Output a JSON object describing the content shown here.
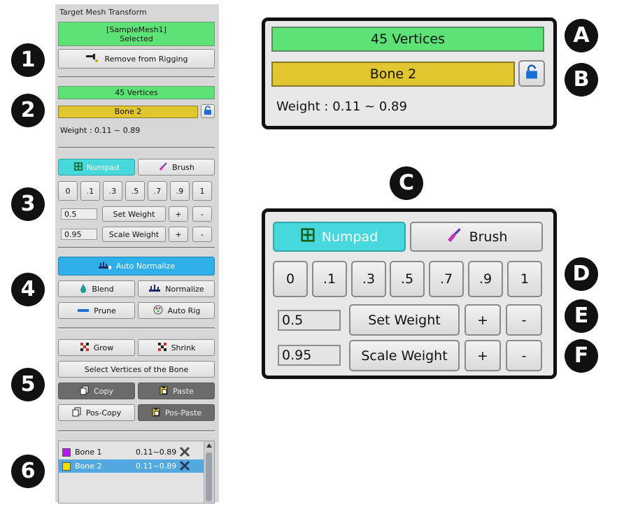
{
  "markers": [
    "1",
    "2",
    "3",
    "4",
    "5",
    "6",
    "A",
    "B",
    "C",
    "D",
    "E",
    "F"
  ],
  "panel": {
    "title": "Target Mesh Transform",
    "selected_mesh": "[SampleMesh1]",
    "selected_state": "Selected",
    "remove_rigging": "Remove from Rigging",
    "vertices": "45 Vertices",
    "bone": "Bone 2",
    "weight": "Weight : 0.11 ~ 0.89",
    "numpad": "Numpad",
    "brush": "Brush",
    "numkeys": [
      "0",
      ".1",
      ".3",
      ".5",
      ".7",
      ".9",
      "1"
    ],
    "set_value": "0.5",
    "set_weight": "Set Weight",
    "scale_value": "0.95",
    "scale_weight": "Scale Weight",
    "plus": "+",
    "minus": "-",
    "auto_normalize": "Auto Normalize",
    "blend": "Blend",
    "normalize": "Normalize",
    "prune": "Prune",
    "auto_rig": "Auto Rig",
    "grow": "Grow",
    "shrink": "Shrink",
    "select_vertices": "Select Vertices of the Bone",
    "copy": "Copy",
    "paste": "Paste",
    "pos_copy": "Pos-Copy",
    "pos_paste": "Pos-Paste",
    "bones": [
      {
        "name": "Bone 1",
        "range": "0.11~0.89",
        "color": "#b01ee6"
      },
      {
        "name": "Bone 2",
        "range": "0.11~0.89",
        "color": "#f2e000"
      }
    ]
  },
  "colors": {
    "green": "#5de276",
    "yellow": "#e2c62f",
    "cyan": "#46d8dc",
    "blue": "#2fb0e8",
    "selected_row": "#52a9e0"
  },
  "icons": [
    "wrench-icon",
    "lock-open-icon",
    "numpad-icon",
    "brush-icon",
    "auto-normalize-icon",
    "blend-icon",
    "normalize-icon",
    "prune-icon",
    "auto-rig-icon",
    "grow-icon",
    "shrink-icon",
    "copy-icon",
    "paste-icon",
    "pos-copy-icon",
    "pos-paste-icon",
    "remove-x-icon"
  ]
}
